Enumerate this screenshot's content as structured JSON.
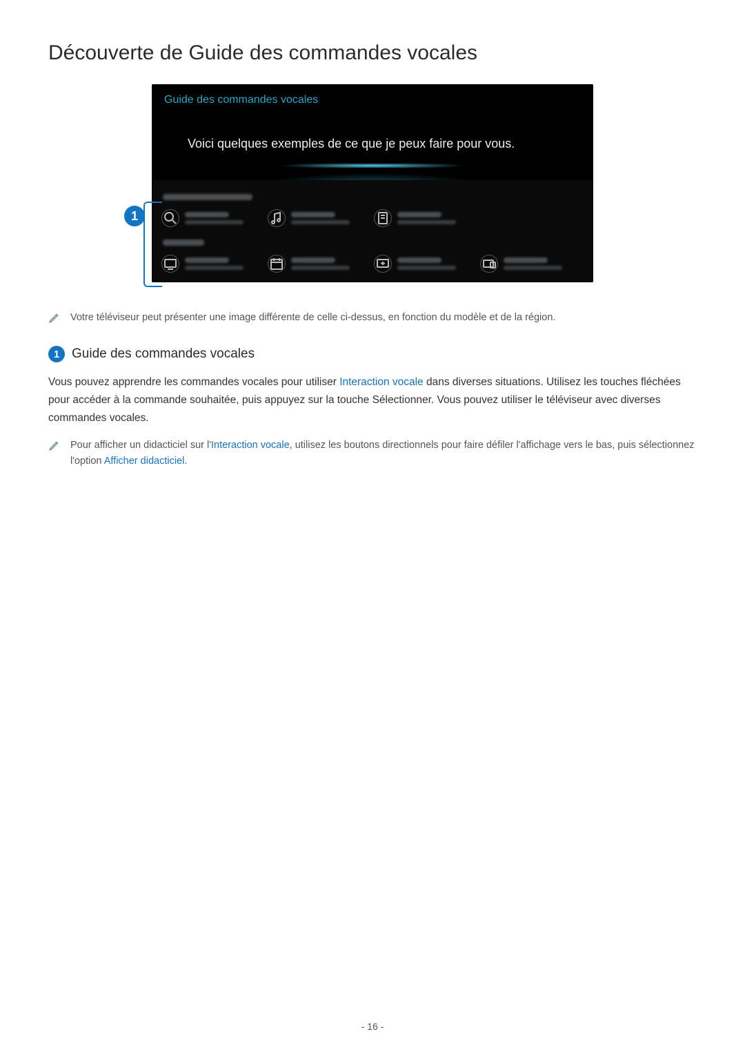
{
  "heading": "Découverte de Guide des commandes vocales",
  "tv": {
    "header": "Guide des commandes vocales",
    "hero": "Voici quelques exemples de ce que je peux faire pour vous."
  },
  "callout_number": "1",
  "note1": "Votre téléviseur peut présenter une image différente de celle ci-dessus, en fonction du modèle et de la région.",
  "sub": {
    "number": "1",
    "title": "Guide des commandes vocales"
  },
  "para": {
    "t1": "Vous pouvez apprendre les commandes vocales pour utiliser ",
    "link1": "Interaction vocale",
    "t2": " dans diverses situations. Utilisez les touches fléchées pour accéder à la commande souhaitée, puis appuyez sur la touche Sélectionner. Vous pouvez utiliser le téléviseur avec diverses commandes vocales."
  },
  "note2": {
    "t1": "Pour afficher un didacticiel sur l'",
    "link1": "Interaction vocale",
    "t2": ", utilisez les boutons directionnels pour faire défiler l'affichage vers le bas, puis sélectionnez l'option ",
    "link2": "Afficher didacticiel",
    "t3": "."
  },
  "page_number": "- 16 -"
}
